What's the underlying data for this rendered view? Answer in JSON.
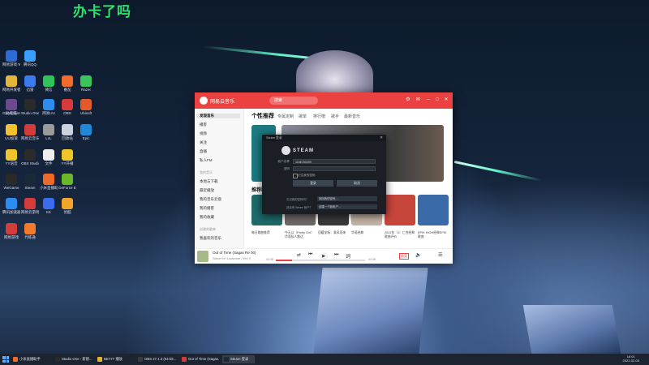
{
  "overlay": {
    "text": "办卡了吗"
  },
  "desktop_icons": [
    {
      "name": "icon-1",
      "label": "网易游戏 Welcome",
      "color": "#2d6bd6"
    },
    {
      "name": "icon-2",
      "label": "腾讯QQ",
      "color": "#3aa0ff"
    },
    {
      "name": "icon-3",
      "label": "网易开发者",
      "color": "#e3b63b"
    },
    {
      "name": "icon-4",
      "label": "迅雷",
      "color": "#3a7cf0"
    },
    {
      "name": "icon-5",
      "label": "微信",
      "color": "#2fc35a"
    },
    {
      "name": "icon-6",
      "label": "番茄",
      "color": "#f26b2a"
    },
    {
      "name": "icon-7",
      "label": "Razer",
      "color": "#3bc45c"
    },
    {
      "name": "icon-8",
      "label": "此电脑",
      "color": "#3b8ce6"
    },
    {
      "name": "icon-9",
      "label": "Studio One_V3.5",
      "color": "#2a2a2a"
    },
    {
      "name": "icon-10",
      "label": "网易UU",
      "color": "#2d8cf0"
    },
    {
      "name": "icon-11",
      "label": "OBS",
      "color": "#d73a3a"
    },
    {
      "name": "icon-12",
      "label": "Ubisoft",
      "color": "#e45a2a"
    },
    {
      "name": "icon-13",
      "label": "Ghost Hunter",
      "color": "#6a4a8c"
    },
    {
      "name": "icon-14",
      "label": "UU加速",
      "color": "#f2c12e"
    },
    {
      "name": "icon-15",
      "label": "网易云音乐",
      "color": "#d43c3c"
    },
    {
      "name": "icon-16",
      "label": "LoL",
      "color": "#9a9a9a"
    },
    {
      "name": "icon-17",
      "label": "回收站",
      "color": "#c9d2dd"
    },
    {
      "name": "icon-18",
      "label": "Epic",
      "color": "#1f88d9"
    },
    {
      "name": "icon-19",
      "label": "YY语音",
      "color": "#f0c52a"
    },
    {
      "name": "icon-20",
      "label": "OBS Studio",
      "color": "#2b2b2b"
    },
    {
      "name": "icon-21",
      "label": "文件",
      "color": "#eeeeee"
    },
    {
      "name": "icon-22",
      "label": "YY开播",
      "color": "#f0c52a"
    },
    {
      "name": "icon-23",
      "label": "WeGame",
      "color": "#2a2a2a"
    },
    {
      "name": "icon-24",
      "label": "Steam",
      "color": "#1b2838"
    },
    {
      "name": "icon-25",
      "label": "小米直播助手",
      "color": "#ef6a2a"
    },
    {
      "name": "icon-26",
      "label": "GeForce Experience",
      "color": "#6ab82a"
    },
    {
      "name": "icon-27",
      "label": "腾讯加速器",
      "color": "#2d8cf0"
    },
    {
      "name": "icon-28",
      "label": "网易云游戏",
      "color": "#d43c3c"
    },
    {
      "name": "icon-29",
      "label": "KK",
      "color": "#3a6cf0"
    },
    {
      "name": "icon-30",
      "label": "优酷",
      "color": "#f2a52a"
    },
    {
      "name": "icon-31",
      "label": "网易游戏",
      "color": "#d43c3c"
    },
    {
      "name": "icon-32",
      "label": "代练通",
      "color": "#f27a2a"
    }
  ],
  "music": {
    "title": "网易云音乐",
    "search": "搜索",
    "sidebar": {
      "items": [
        "发现音乐",
        "播客",
        "视频",
        "关注",
        "直播",
        "私人FM"
      ],
      "group_mine": "我的音乐",
      "mine_items": [
        "本地与下载",
        "最近播放",
        "我的音乐云盘",
        "我的播客",
        "我的收藏"
      ],
      "group_created": "创建的歌单",
      "created_items": [
        "我喜欢的音乐"
      ]
    },
    "tabs": [
      "个性推荐",
      "专属定制",
      "歌单",
      "排行榜",
      "歌手",
      "最新音乐"
    ],
    "section_title": "推荐歌单",
    "cards": [
      {
        "caption": "每日歌曲推荐",
        "color": "#1f6b6a"
      },
      {
        "caption": "今天以（Pretty Girl）华语私人雷达",
        "color": "#6e6a66"
      },
      {
        "caption": "回暖坐标：乘风而来",
        "color": "#3a3a3a"
      },
      {
        "caption": "华语经典",
        "color": "#c5b5a6"
      },
      {
        "caption": "2022年（1）仁合经典歌曲评价",
        "color": "#c7463c"
      },
      {
        "caption": "EPIK HIGH经典EPIK歌曲",
        "color": "#3a6aa8"
      }
    ],
    "player": {
      "song": "Out of Time (Sagas Re 00)",
      "artist": "Steve M / Lucienne / Ehl X",
      "time_current": "00:36",
      "time_total": "03:38",
      "progress": 0.18,
      "quality": "极高"
    }
  },
  "steam_dialog": {
    "title": "Steam 登录",
    "logo": "STEAM",
    "account_label": "帐户名称",
    "account_value": "1186780059",
    "password_label": "密码",
    "password_value": "",
    "remember_label": "记住我的密码",
    "login_button": "登录",
    "cancel_button": "取消",
    "help1_label": "忘记我的密码吗？",
    "help1_button": "找回我的密码…",
    "help2_label": "还没有 Steam 帐户？",
    "help2_button": "创建一个新帐户…"
  },
  "taskbar": {
    "items": [
      {
        "label": "小米直播助手",
        "color": "#ef6a2a"
      },
      {
        "label": "Studio One - 新建...",
        "color": "#2a2a2a"
      },
      {
        "label": "BET77 播放",
        "color": "#e3b63b"
      },
      {
        "label": "OBS 27.1.3 (64-bit...",
        "color": "#3a3a3a"
      },
      {
        "label": "Out of Time (Sagas...",
        "color": "#d43c3c"
      },
      {
        "label": "Steam 登录",
        "color": "#1b2838"
      }
    ],
    "time": "16:01",
    "date": "2022-02-05"
  }
}
